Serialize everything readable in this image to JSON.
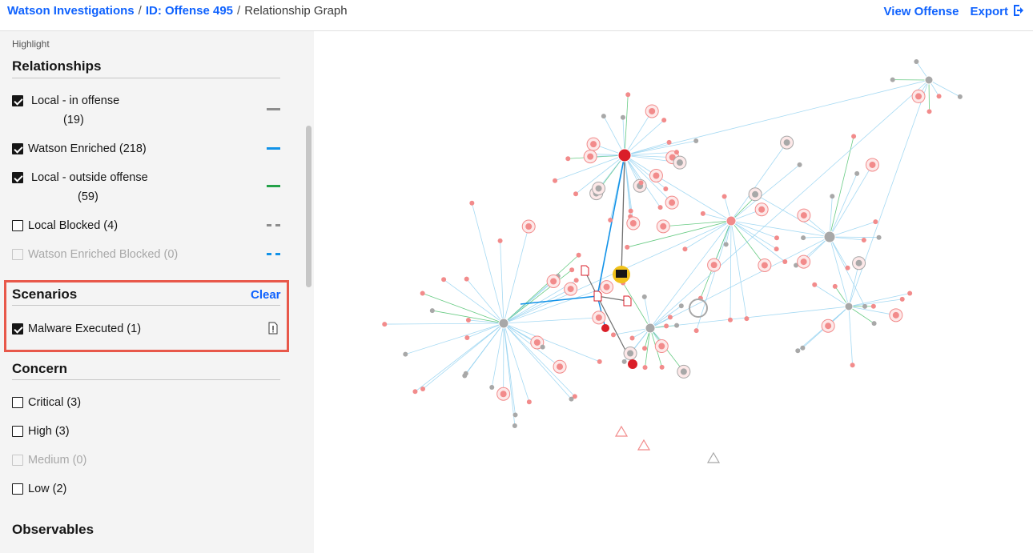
{
  "breadcrumb": {
    "root": "Watson Investigations",
    "offense": "ID: Offense 495",
    "current": "Relationship Graph",
    "separator": "/"
  },
  "actions": {
    "view_offense": "View Offense",
    "export": "Export"
  },
  "sidebar": {
    "highlight_label": "Highlight",
    "relationships": {
      "title": "Relationships",
      "items": [
        {
          "label": "Local - in offense",
          "count": "(19)",
          "checked": true,
          "enabled": true,
          "legend_color": "#8d8d8d",
          "legend_style": "solid"
        },
        {
          "label": "Watson Enriched (218)",
          "checked": true,
          "enabled": true,
          "legend_color": "#1192e8",
          "legend_style": "solid"
        },
        {
          "label": "Local - outside offense",
          "count": "(59)",
          "checked": true,
          "enabled": true,
          "legend_color": "#24a148",
          "legend_style": "solid"
        },
        {
          "label": "Local Blocked (4)",
          "checked": false,
          "enabled": true,
          "legend_color": "#8d8d8d",
          "legend_style": "dashed"
        },
        {
          "label": "Watson Enriched Blocked (0)",
          "checked": false,
          "enabled": false,
          "legend_color": "#1192e8",
          "legend_style": "dashed"
        }
      ]
    },
    "scenarios": {
      "title": "Scenarios",
      "clear": "Clear",
      "items": [
        {
          "label": "Malware Executed (1)",
          "checked": true
        }
      ]
    },
    "concern": {
      "title": "Concern",
      "items": [
        {
          "label": "Critical (3)",
          "checked": false,
          "enabled": true
        },
        {
          "label": "High (3)",
          "checked": false,
          "enabled": true
        },
        {
          "label": "Medium (0)",
          "checked": false,
          "enabled": false
        },
        {
          "label": "Low (2)",
          "checked": false,
          "enabled": true
        }
      ]
    },
    "observables": {
      "title": "Observables"
    }
  },
  "graph": {
    "colors": {
      "enriched": "#8fd0f0",
      "local": "#6f6f6f",
      "outside": "#42be65",
      "threat": "#f28b8b",
      "threat_dark": "#da1e28",
      "neutral": "#a8a8a8",
      "highlight": "#f1c21b",
      "selected_edge": "#1192e8"
    }
  }
}
